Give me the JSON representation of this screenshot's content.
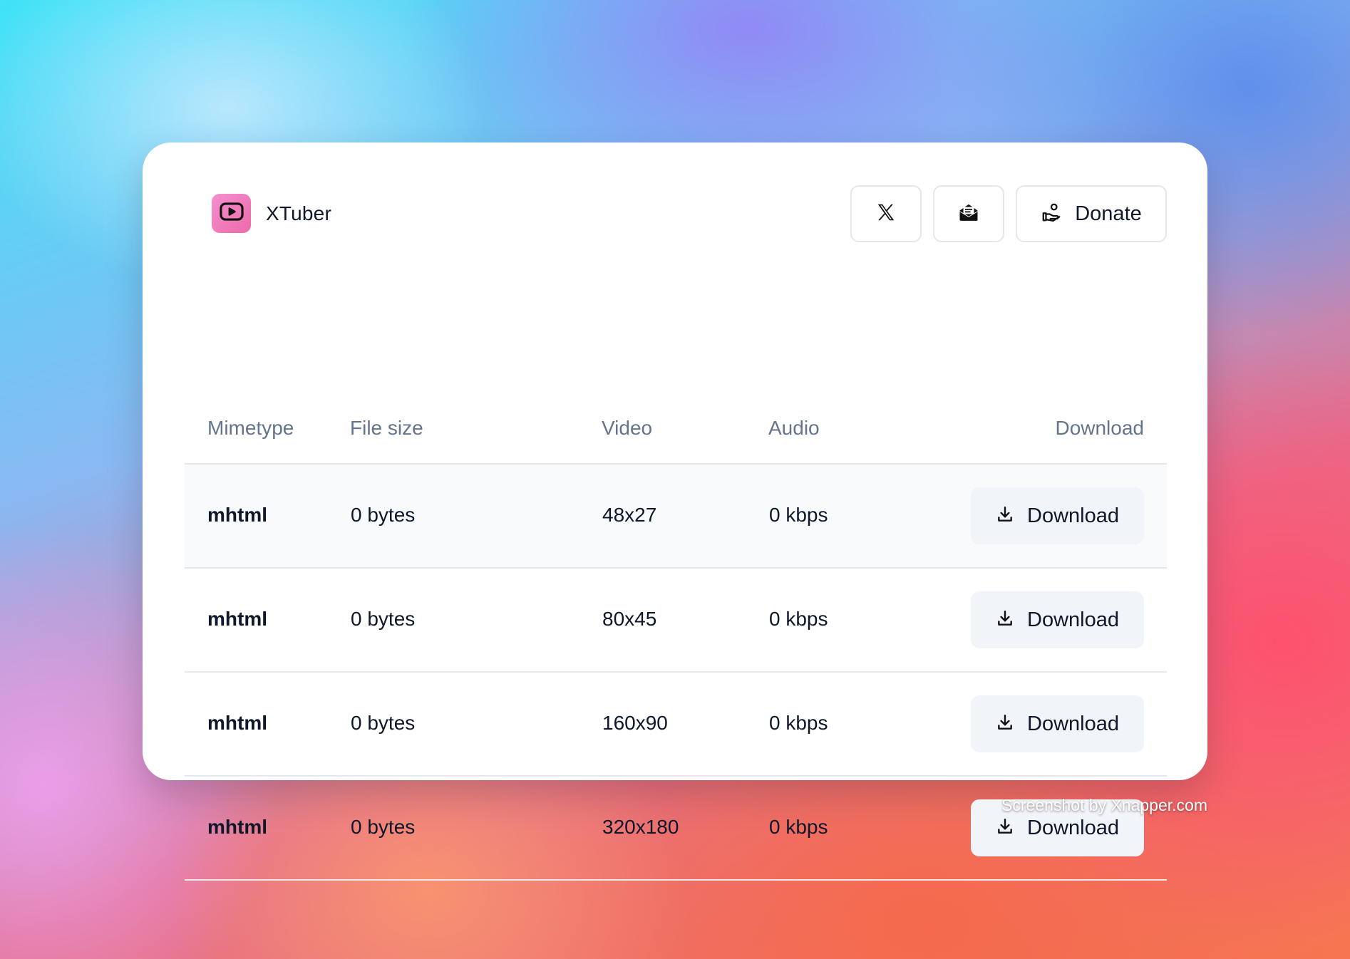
{
  "app": {
    "name": "XTuber",
    "logo_icon": "play-icon",
    "logo_gradient": [
      "#f58fd0",
      "#ec6aa8"
    ]
  },
  "header_actions": {
    "x_icon": "x-logo-icon",
    "mail_icon": "envelope-open-icon",
    "donate_label": "Donate",
    "donate_icon": "hand-coin-icon"
  },
  "table": {
    "headers": {
      "mimetype": "Mimetype",
      "file_size": "File size",
      "video": "Video",
      "audio": "Audio",
      "download": "Download"
    },
    "rows": [
      {
        "mimetype": "mhtml",
        "file_size": "0 bytes",
        "video": "48x27",
        "audio": "0 kbps",
        "download_label": "Download"
      },
      {
        "mimetype": "mhtml",
        "file_size": "0 bytes",
        "video": "80x45",
        "audio": "0 kbps",
        "download_label": "Download"
      },
      {
        "mimetype": "mhtml",
        "file_size": "0 bytes",
        "video": "160x90",
        "audio": "0 kbps",
        "download_label": "Download"
      },
      {
        "mimetype": "mhtml",
        "file_size": "0 bytes",
        "video": "320x180",
        "audio": "0 kbps",
        "download_label": "Download"
      }
    ],
    "download_icon": "download-icon"
  },
  "watermark": "Screenshot by Xnapper.com"
}
